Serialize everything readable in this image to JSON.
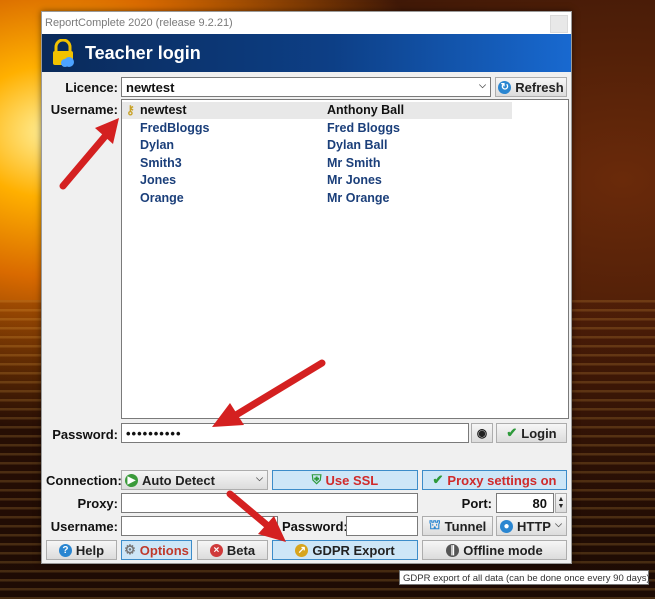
{
  "window": {
    "title": "ReportComplete 2020 (release 9.2.21)"
  },
  "header": {
    "title": "Teacher login"
  },
  "licence": {
    "label": "Licence:",
    "value": "newtest",
    "refresh_label": "Refresh"
  },
  "username_label": "Username:",
  "users": [
    {
      "username": "newtest",
      "fullname": "Anthony Ball",
      "selected": true
    },
    {
      "username": "FredBloggs",
      "fullname": "Fred Bloggs"
    },
    {
      "username": "Dylan",
      "fullname": "Dylan Ball"
    },
    {
      "username": "Smith3",
      "fullname": "Mr Smith"
    },
    {
      "username": "Jones",
      "fullname": "Mr Jones"
    },
    {
      "username": "Orange",
      "fullname": "Mr Orange"
    }
  ],
  "password": {
    "label": "Password:",
    "value": "••••••••••",
    "login_label": "Login"
  },
  "connection": {
    "label": "Connection:",
    "value": "Auto Detect",
    "ssl_label": "Use SSL",
    "proxy_settings_label": "Proxy settings on"
  },
  "proxy": {
    "label": "Proxy:",
    "value": "",
    "port_label": "Port:",
    "port_value": "80"
  },
  "proxy_auth": {
    "username_label": "Username:",
    "username_value": "",
    "password_label": "Password:",
    "password_value": "",
    "tunnel_label": "Tunnel",
    "protocol_value": "HTTP"
  },
  "footer": {
    "help_label": "Help",
    "options_label": "Options",
    "beta_label": "Beta",
    "gdpr_label": "GDPR Export",
    "offline_label": "Offline mode"
  },
  "tooltip": "GDPR export of all data (can be done once every 90 days).",
  "colors": {
    "accent_blue": "#1b3f7a",
    "ssl_bg": "#cde6f7",
    "options_red": "#c0392b",
    "arrow_red": "#d42020"
  }
}
